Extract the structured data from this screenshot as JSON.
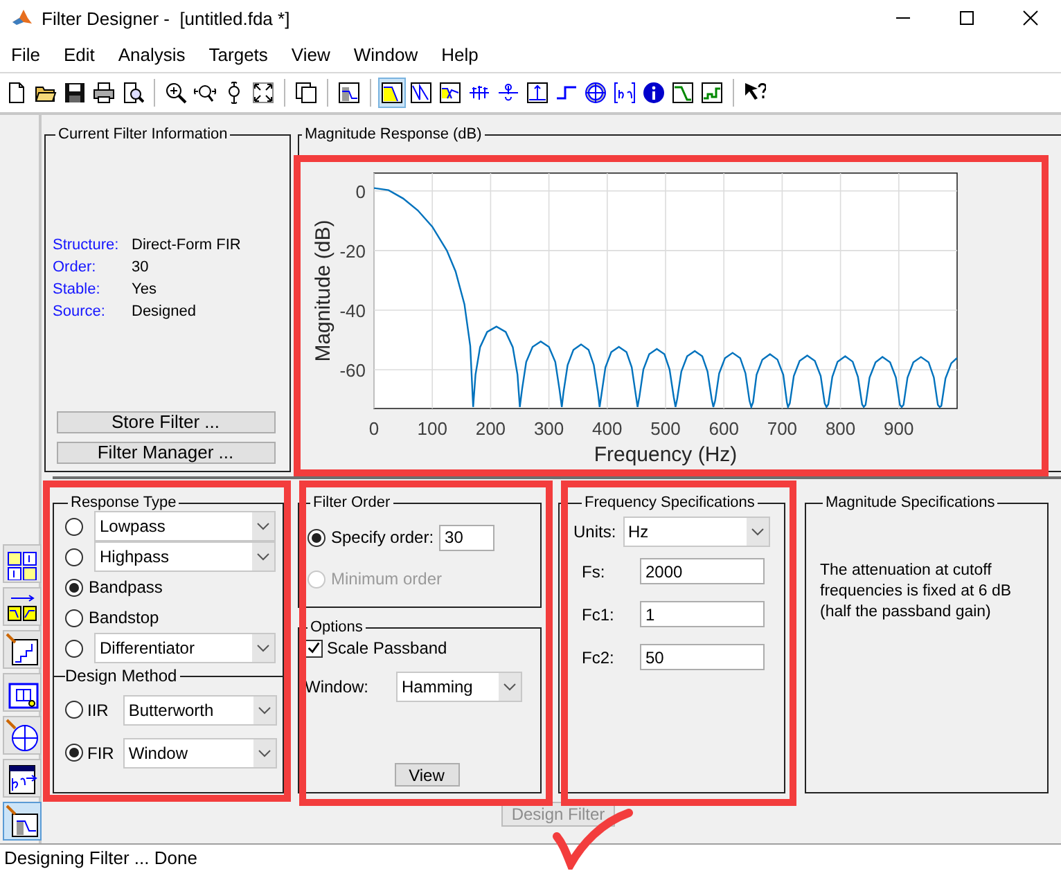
{
  "window": {
    "title": "Filter Designer -  [untitled.fda *]"
  },
  "menu": [
    {
      "label": "File"
    },
    {
      "label": "Edit"
    },
    {
      "label": "Analysis"
    },
    {
      "label": "Targets"
    },
    {
      "label": "View"
    },
    {
      "label": "Window"
    },
    {
      "label": "Help"
    }
  ],
  "toolbar_groups": [
    [
      {
        "kind": "new",
        "selected": false
      },
      {
        "kind": "open",
        "selected": false
      },
      {
        "kind": "save",
        "selected": false
      },
      {
        "kind": "print",
        "selected": false
      },
      {
        "kind": "preview",
        "selected": false
      }
    ],
    [
      {
        "kind": "zoom-in",
        "selected": false
      },
      {
        "kind": "zoom-x",
        "selected": false
      },
      {
        "kind": "zoom-y",
        "selected": false
      },
      {
        "kind": "fit",
        "selected": false
      }
    ],
    [
      {
        "kind": "windows",
        "selected": false
      }
    ],
    [
      {
        "kind": "spec",
        "selected": false
      }
    ],
    [
      {
        "kind": "magnitude",
        "selected": true
      },
      {
        "kind": "phase",
        "selected": false
      },
      {
        "kind": "magphase",
        "selected": false
      },
      {
        "kind": "groupdelay",
        "selected": false
      },
      {
        "kind": "phasedelay",
        "selected": false
      },
      {
        "kind": "impulse",
        "selected": false
      },
      {
        "kind": "step",
        "selected": false
      },
      {
        "kind": "polezero",
        "selected": false
      },
      {
        "kind": "coeffs",
        "selected": false
      },
      {
        "kind": "info",
        "selected": false
      },
      {
        "kind": "magest",
        "selected": false
      },
      {
        "kind": "noise",
        "selected": false
      }
    ],
    [
      {
        "kind": "whatsthis",
        "selected": false
      }
    ]
  ],
  "side_tools": [
    {
      "kind": "realize",
      "selected": false
    },
    {
      "kind": "transform",
      "selected": false
    },
    {
      "kind": "quantize",
      "selected": false
    },
    {
      "kind": "multirate",
      "selected": false
    },
    {
      "kind": "polezero",
      "selected": false
    },
    {
      "kind": "import",
      "selected": false
    },
    {
      "kind": "design",
      "selected": true
    }
  ],
  "filter_info": {
    "title": "Current Filter Information",
    "fields": [
      {
        "label": "Structure:",
        "value": "Direct-Form FIR"
      },
      {
        "label": "Order:",
        "value": "30"
      },
      {
        "label": "Stable:",
        "value": "Yes"
      },
      {
        "label": "Source:",
        "value": "Designed"
      }
    ],
    "buttons": [
      "Store Filter ...",
      "Filter Manager ..."
    ]
  },
  "magnitude_response": {
    "title": "Magnitude Response (dB)",
    "chart_data": {
      "type": "line",
      "grid": true,
      "xlabel": "Frequency (Hz)",
      "ylabel": "Magnitude (dB)",
      "xlim": [
        0,
        1000
      ],
      "ylim": [
        -73,
        6
      ],
      "xticks": [
        0,
        100,
        200,
        300,
        400,
        500,
        600,
        700,
        800,
        900
      ],
      "yticks": [
        0,
        -20,
        -40,
        -60
      ],
      "x": [
        0,
        25,
        50,
        75,
        100,
        125,
        140,
        155,
        165,
        170,
        174,
        182,
        194,
        210,
        226,
        238,
        246,
        250,
        254,
        261,
        272,
        286,
        300,
        311,
        318,
        322,
        325,
        332,
        342,
        355,
        368,
        377,
        384,
        387,
        390,
        397,
        407,
        420,
        433,
        442,
        449,
        452,
        455,
        462,
        472,
        485,
        498,
        507,
        514,
        517,
        520,
        527,
        537,
        550,
        563,
        572,
        579,
        582,
        585,
        592,
        602,
        615,
        628,
        637,
        644,
        647,
        650,
        656,
        666,
        679,
        692,
        702,
        708,
        710,
        713,
        720,
        730,
        743,
        756,
        766,
        773,
        776,
        779,
        786,
        795,
        808,
        821,
        830,
        837,
        840,
        843,
        850,
        860,
        872,
        885,
        895,
        902,
        905,
        908,
        915,
        925,
        938,
        951,
        960,
        967,
        970,
        973,
        980,
        990,
        1000
      ],
      "series": [
        {
          "color": "#0072bd",
          "values": [
            1,
            0.3,
            -2.5,
            -6.5,
            -12,
            -20,
            -27,
            -38,
            -52,
            -72.5,
            -61.6,
            -52.4,
            -47.3,
            -45.5,
            -47.3,
            -52.4,
            -61.6,
            -72.5,
            -66.6,
            -57.4,
            -52.3,
            -50.5,
            -52.3,
            -57.4,
            -66.6,
            -72.5,
            -67.6,
            -58.4,
            -53.3,
            -51.5,
            -53.3,
            -58.4,
            -67.6,
            -72.5,
            -68.4,
            -59.2,
            -54.1,
            -52.3,
            -54.1,
            -59.2,
            -68.4,
            -72.5,
            -69.1,
            -59.9,
            -54.8,
            -53,
            -54.8,
            -59.9,
            -69.1,
            -72.5,
            -69.8,
            -60.6,
            -55.5,
            -53.7,
            -55.5,
            -60.6,
            -69.8,
            -72.5,
            -70.4,
            -61.2,
            -56.1,
            -54.3,
            -56.1,
            -61.2,
            -70.4,
            -72.5,
            -70.9,
            -61.7,
            -56.6,
            -54.8,
            -56.6,
            -61.7,
            -70.9,
            -72.5,
            -71.3,
            -62.1,
            -57,
            -55.2,
            -57,
            -62.1,
            -71.3,
            -72.5,
            -71.6,
            -62.4,
            -57.3,
            -55.5,
            -57.3,
            -62.4,
            -71.6,
            -72.5,
            -71.8,
            -62.6,
            -57.5,
            -55.7,
            -57.5,
            -62.6,
            -71.8,
            -72.5,
            -71.8,
            -62.6,
            -57.5,
            -55.7,
            -57.5,
            -62.6,
            -71.8,
            -72.5,
            -72.1,
            -62.9,
            -57.8,
            -56
          ]
        }
      ]
    }
  },
  "response_type": {
    "title": "Response Type",
    "options": [
      {
        "kind": "dropdown",
        "value": "Lowpass",
        "selected": false
      },
      {
        "kind": "dropdown",
        "value": "Highpass",
        "selected": false
      },
      {
        "kind": "label",
        "label": "Bandpass",
        "selected": true
      },
      {
        "kind": "label",
        "label": "Bandstop",
        "selected": false
      },
      {
        "kind": "dropdown",
        "value": "Differentiator",
        "selected": false
      }
    ]
  },
  "design_method": {
    "title": "Design Method",
    "options": [
      {
        "label": "IIR",
        "value": "Butterworth",
        "selected": false
      },
      {
        "label": "FIR",
        "value": "Window",
        "selected": true
      }
    ]
  },
  "filter_order": {
    "title": "Filter Order",
    "options": [
      {
        "kind": "input",
        "label": "Specify order:",
        "value": "30",
        "selected": true,
        "disabled": false
      },
      {
        "kind": "plain",
        "label": "Minimum order",
        "selected": false,
        "disabled": true
      }
    ]
  },
  "options": {
    "title": "Options",
    "scale_passband": {
      "label": "Scale Passband",
      "checked": true
    },
    "window": {
      "label": "Window:",
      "value": "Hamming"
    },
    "button": "View"
  },
  "frequency_specs": {
    "title": "Frequency Specifications",
    "units": {
      "label": "Units:",
      "value": "Hz"
    },
    "fields": [
      {
        "label": "Fs:",
        "value": "2000"
      },
      {
        "label": "Fc1:",
        "value": "1"
      },
      {
        "label": "Fc2:",
        "value": "50"
      }
    ]
  },
  "magnitude_specs": {
    "title": "Magnitude Specifications",
    "note": "The attenuation at cutoff frequencies is fixed at 6 dB (half the passband gain)"
  },
  "design_button": {
    "label": "Design Filter",
    "disabled": true
  },
  "status_bar": "Designing Filter ... Done"
}
